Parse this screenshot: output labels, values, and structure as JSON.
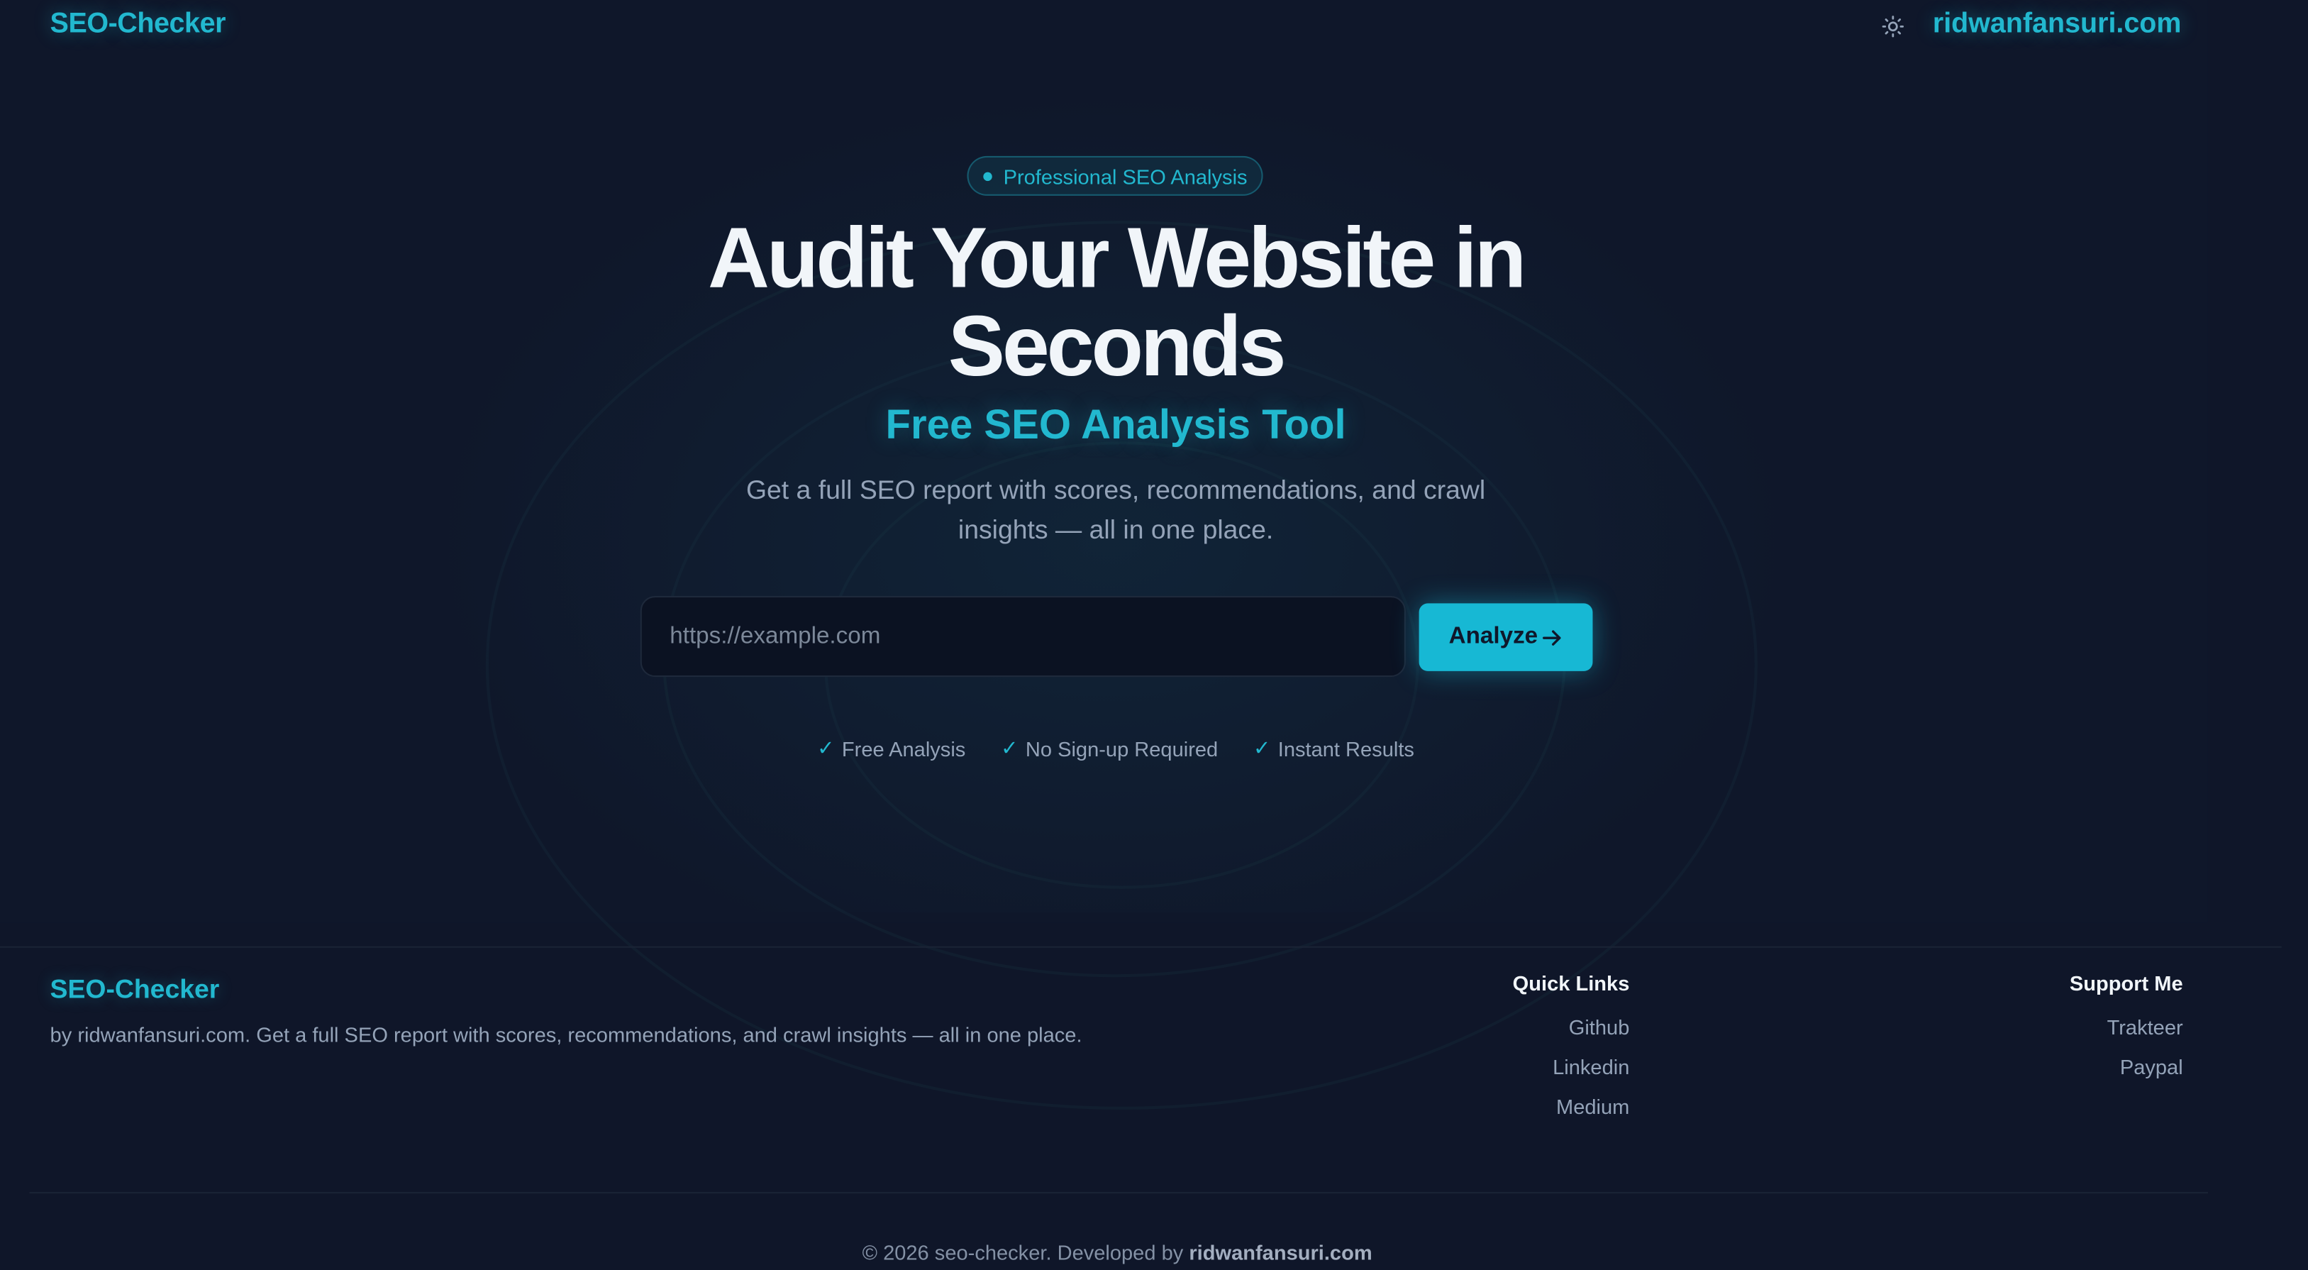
{
  "header": {
    "logo": "SEO-Checker",
    "theme_toggle_icon": "sun-icon",
    "site_link": "ridwanfansuri.com"
  },
  "hero": {
    "badge": "Professional SEO Analysis",
    "title_line1": "Audit Your Website in",
    "title_line2": "Seconds",
    "subtitle": "Free SEO Analysis Tool",
    "description": "Get a full SEO report with scores, recommendations, and crawl insights — all in one place.",
    "input_placeholder": "https://example.com",
    "input_value": "",
    "analyze_label": "Analyze",
    "analyze_icon": "arrow-right-icon",
    "features": [
      {
        "icon": "check-icon",
        "label": "Free Analysis"
      },
      {
        "icon": "check-icon",
        "label": "No Sign-up Required"
      },
      {
        "icon": "check-icon",
        "label": "Instant Results"
      }
    ]
  },
  "footer": {
    "logo": "SEO-Checker",
    "description": "by ridwanfansuri.com. Get a full SEO report with scores, recommendations, and crawl insights — all in one place.",
    "quick_links": {
      "heading": "Quick Links",
      "items": [
        "Github",
        "Linkedin",
        "Medium"
      ]
    },
    "support": {
      "heading": "Support Me",
      "items": [
        "Trakteer",
        "Paypal"
      ]
    },
    "copyright_prefix": "© 2026 seo-checker. Developed by",
    "copyright_author": "ridwanfansuri.com"
  },
  "colors": {
    "background": "#0f1629",
    "accent": "#22b8cf",
    "button": "#17b8d4",
    "text_muted": "#94a3b8",
    "heading": "#f1f5f9"
  }
}
